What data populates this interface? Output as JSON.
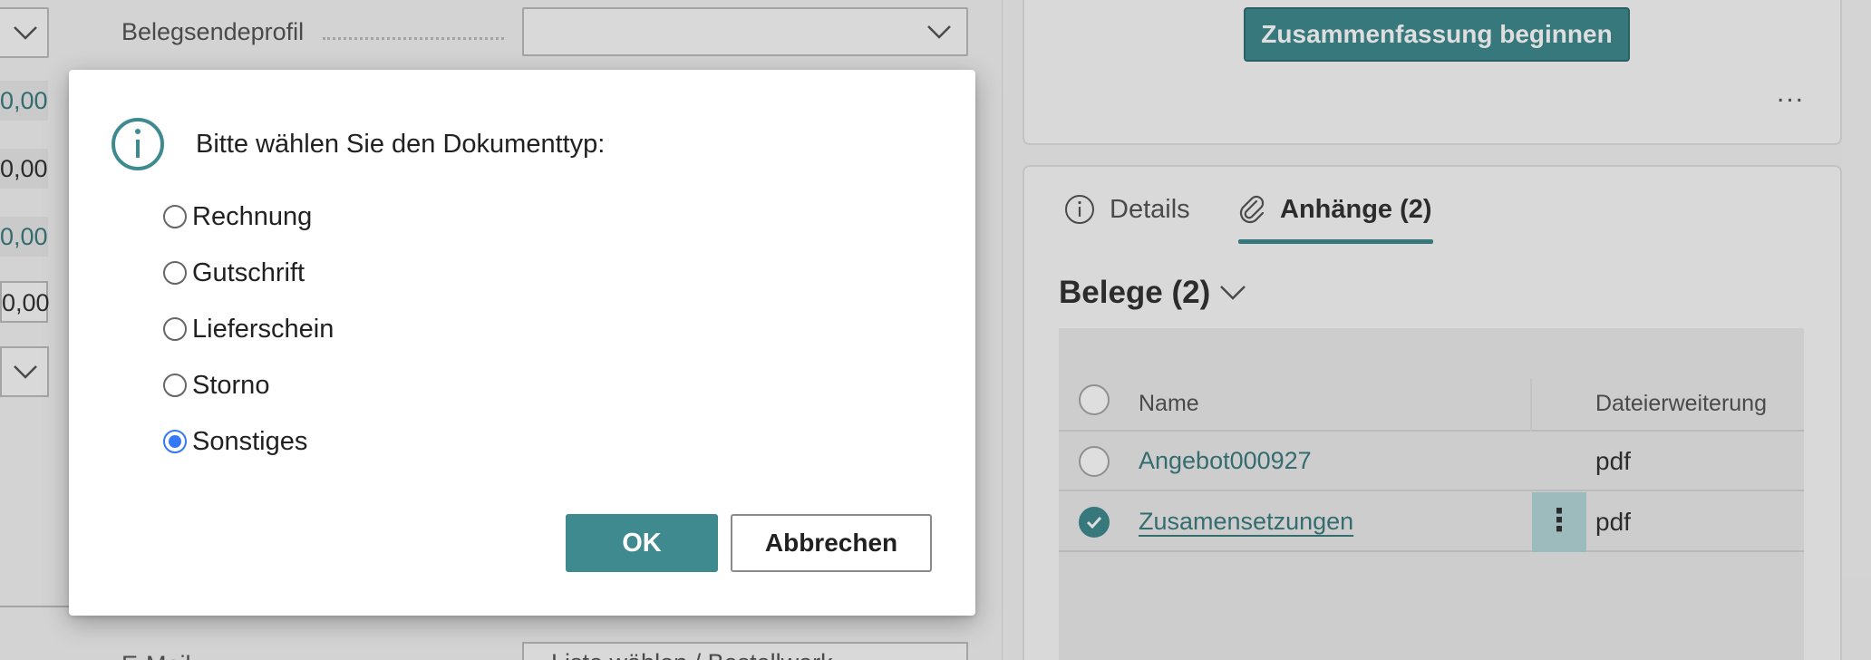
{
  "background": {
    "left": {
      "field_label": "Belegsendeprofil",
      "amounts": [
        "0,00",
        "0,00",
        "0,00",
        "0,00"
      ],
      "bottom_label": "E-Mail",
      "bottom_select_value": "Liste wählen / Bestellwerk"
    },
    "right": {
      "summary_button": "Zusammenfassung beginnen",
      "more_label": "...",
      "tabs": [
        {
          "label": "Details",
          "icon": "info-icon"
        },
        {
          "label": "Anhänge (2)",
          "icon": "paperclip-icon",
          "active": true
        }
      ],
      "belege_title": "Belege (2)",
      "table": {
        "columns": [
          "Name",
          "Dateierweiterung"
        ],
        "rows": [
          {
            "name": "Angebot000927",
            "ext": "pdf",
            "selected": false
          },
          {
            "name": "Zusamensetzungen",
            "ext": "pdf",
            "selected": true
          }
        ],
        "row_menu": "⋮"
      }
    }
  },
  "dialog": {
    "icon": "info-circle-icon",
    "prompt": "Bitte wählen Sie den Dokumenttyp:",
    "options": [
      "Rechnung",
      "Gutschrift",
      "Lieferschein",
      "Storno",
      "Sonstiges"
    ],
    "selected_option": "Sonstiges",
    "ok_label": "OK",
    "cancel_label": "Abbrechen"
  },
  "colors": {
    "accent": "#3f8a8f",
    "radio_selected": "#3478f6"
  }
}
